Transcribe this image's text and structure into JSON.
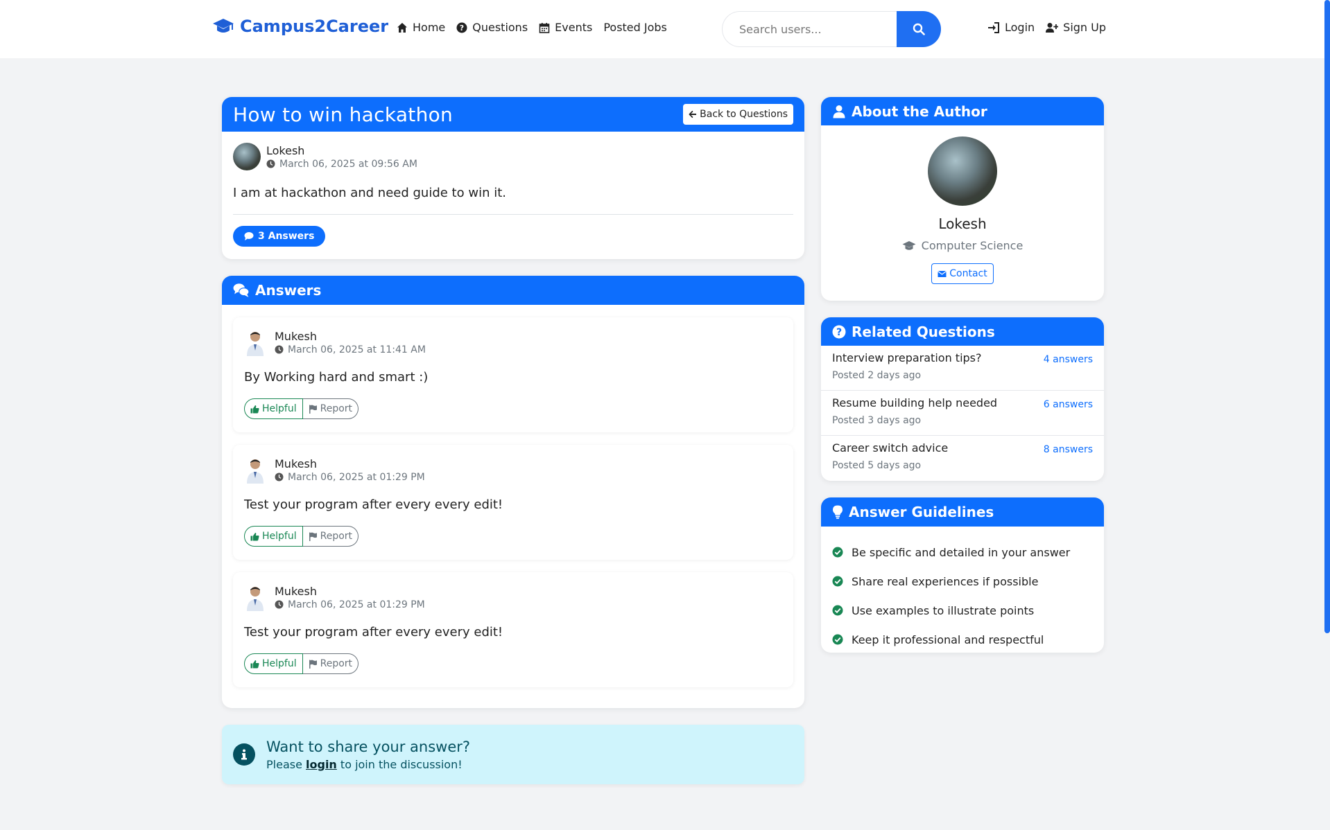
{
  "navbar": {
    "brand": "Campus2Career",
    "links": [
      "Home",
      "Questions",
      "Events",
      "Posted Jobs"
    ],
    "search_placeholder": "Search users...",
    "login": "Login",
    "signup": "Sign Up"
  },
  "question": {
    "title": "How to win hackathon",
    "back_label": "Back to Questions",
    "author": "Lokesh",
    "date": "March 06, 2025 at 09:56 AM",
    "body": "I am at hackathon and need guide to win it.",
    "answers_count_label": "3 Answers"
  },
  "answers_section": {
    "title": "Answers",
    "helpful_label": "Helpful",
    "report_label": "Report",
    "items": [
      {
        "author": "Mukesh",
        "date": "March 06, 2025 at 11:41 AM",
        "text": "By Working hard and smart :)"
      },
      {
        "author": "Mukesh",
        "date": "March 06, 2025 at 01:29 PM",
        "text": "Test your program after every every edit!"
      },
      {
        "author": "Mukesh",
        "date": "March 06, 2025 at 01:29 PM",
        "text": "Test your program after every every edit!"
      }
    ]
  },
  "login_prompt": {
    "title": "Want to share your answer?",
    "before": "Please ",
    "link": "login",
    "after": " to join the discussion!"
  },
  "author_card": {
    "title": "About the Author",
    "name": "Lokesh",
    "department": "Computer Science",
    "contact_label": "Contact"
  },
  "related": {
    "title": "Related Questions",
    "items": [
      {
        "question": "Interview preparation tips?",
        "posted": "Posted 2 days ago",
        "count": "4 answers"
      },
      {
        "question": "Resume building help needed",
        "posted": "Posted 3 days ago",
        "count": "6 answers"
      },
      {
        "question": "Career switch advice",
        "posted": "Posted 5 days ago",
        "count": "8 answers"
      }
    ]
  },
  "guidelines": {
    "title": "Answer Guidelines",
    "items": [
      "Be specific and detailed in your answer",
      "Share real experiences if possible",
      "Use examples to illustrate points",
      "Keep it professional and respectful"
    ]
  },
  "colors": {
    "primary": "#0d6efd",
    "brand": "#1f5fd6",
    "success": "#198754",
    "info_bg": "#cff4fc"
  }
}
